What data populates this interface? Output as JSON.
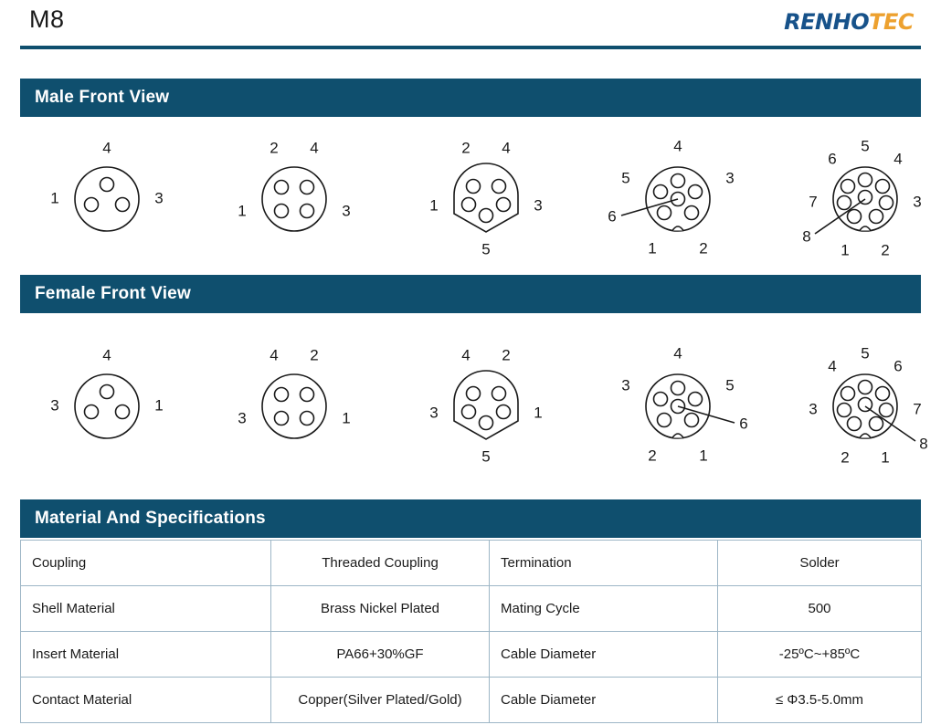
{
  "header": {
    "title": "M8",
    "logo_part_1": "RENHO",
    "logo_part_2": "TEC",
    "logo_color_1": "#17528a",
    "logo_color_2": "#eda12f",
    "rule_color": "#0f4f6e"
  },
  "sections": {
    "male": {
      "title": "Male Front View"
    },
    "female": {
      "title": "Female Front View"
    },
    "specs": {
      "title": "Material And Specifications"
    }
  },
  "male_connectors": [
    {
      "pins": "3",
      "labels": {
        "top": "4",
        "left": "1",
        "right": "3",
        "bottom": "",
        "upper_left": "",
        "upper_right": "",
        "lower_left": "",
        "lower_right": "",
        "center": ""
      }
    },
    {
      "pins": "4",
      "labels": {
        "top": "",
        "left": "1",
        "right": "3",
        "bottom": "",
        "upper_left": "2",
        "upper_right": "4",
        "lower_left": "",
        "lower_right": "",
        "center": ""
      }
    },
    {
      "pins": "5",
      "labels": {
        "top": "",
        "left": "1",
        "right": "3",
        "bottom": "5",
        "upper_left": "2",
        "upper_right": "4",
        "lower_left": "",
        "lower_right": "",
        "center": ""
      }
    },
    {
      "pins": "6",
      "labels": {
        "top": "4",
        "left": "",
        "right": "",
        "bottom": "",
        "upper_left": "5",
        "upper_right": "3",
        "lower_left": "1",
        "lower_right": "2",
        "center": "6"
      }
    },
    {
      "pins": "8",
      "labels": {
        "top": "5",
        "left": "7",
        "right": "3",
        "bottom": "",
        "upper_left": "6",
        "upper_right": "4",
        "lower_left": "1",
        "lower_right": "2",
        "center": "8"
      }
    }
  ],
  "female_connectors": [
    {
      "pins": "3",
      "labels": {
        "top": "4",
        "left": "3",
        "right": "1",
        "bottom": "",
        "upper_left": "",
        "upper_right": "",
        "lower_left": "",
        "lower_right": "",
        "center": ""
      }
    },
    {
      "pins": "4",
      "labels": {
        "top": "",
        "left": "3",
        "right": "1",
        "bottom": "",
        "upper_left": "4",
        "upper_right": "2",
        "lower_left": "",
        "lower_right": "",
        "center": ""
      }
    },
    {
      "pins": "5",
      "labels": {
        "top": "",
        "left": "3",
        "right": "1",
        "bottom": "5",
        "upper_left": "4",
        "upper_right": "2",
        "lower_left": "",
        "lower_right": "",
        "center": ""
      }
    },
    {
      "pins": "6",
      "labels": {
        "top": "4",
        "left": "",
        "right": "",
        "bottom": "",
        "upper_left": "3",
        "upper_right": "5",
        "lower_left": "2",
        "lower_right": "1",
        "center": "6"
      }
    },
    {
      "pins": "8",
      "labels": {
        "top": "5",
        "left": "3",
        "right": "7",
        "bottom": "",
        "upper_left": "4",
        "upper_right": "6",
        "lower_left": "2",
        "lower_right": "1",
        "center": "8"
      }
    }
  ],
  "spec_table": {
    "rows": [
      {
        "label_1": "Coupling",
        "value_1": "Threaded Coupling",
        "label_2": "Termination",
        "value_2": "Solder"
      },
      {
        "label_1": "Shell Material",
        "value_1": "Brass Nickel Plated",
        "label_2": "Mating Cycle",
        "value_2": "500"
      },
      {
        "label_1": "Insert Material",
        "value_1": "PA66+30%GF",
        "label_2": "Cable Diameter",
        "value_2": "-25ºC~+85ºC"
      },
      {
        "label_1": "Contact Material",
        "value_1": "Copper(Silver Plated/Gold)",
        "label_2": "Cable Diameter",
        "value_2": "≤ Φ3.5-5.0mm"
      }
    ]
  },
  "theme": {
    "bar_color": "#0f4f6e",
    "grid_color": "#9db6c6",
    "drawing_color": "#1a1a1a"
  }
}
